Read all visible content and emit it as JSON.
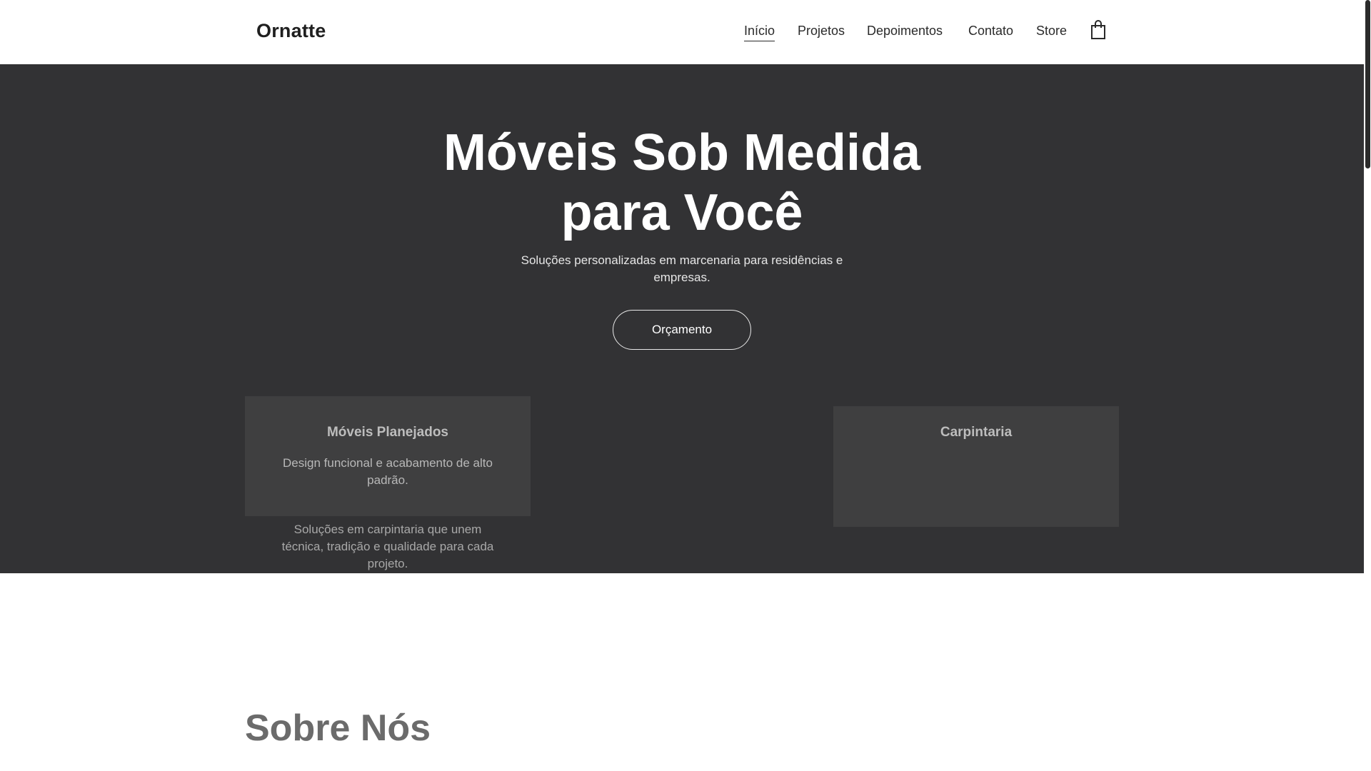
{
  "header": {
    "logo": "Ornatte",
    "nav": [
      {
        "label": "Início",
        "active": true
      },
      {
        "label": "Projetos",
        "active": false
      },
      {
        "label": "Depoimentos",
        "active": false
      },
      {
        "label": "Contato",
        "active": false
      },
      {
        "label": "Store",
        "active": false
      }
    ],
    "cart_icon": "shopping-bag-icon"
  },
  "hero": {
    "title_line1": "Móveis Sob Medida",
    "title_line2": "para Você",
    "subtitle": "Soluções personalizadas em marcenaria para residências e empresas.",
    "cta_label": "Orçamento",
    "background": "#323234"
  },
  "cards": [
    {
      "title": "Móveis Planejados",
      "text": "Design funcional e acabamento de alto padrão."
    },
    {
      "title": "Carpintaria",
      "text": ""
    }
  ],
  "carpentry_text": "Soluções em carpintaria que unem técnica, tradição e qualidade para cada projeto.",
  "about": {
    "title": "Sobre Nós"
  }
}
